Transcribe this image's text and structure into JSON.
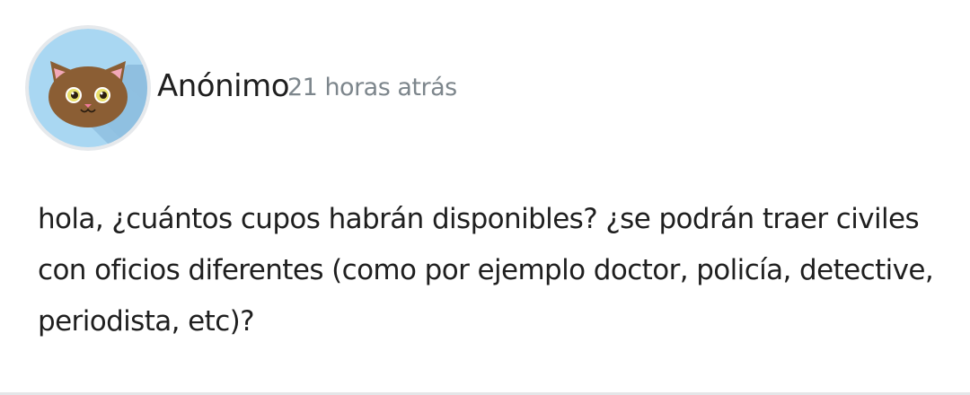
{
  "comment": {
    "avatar_icon": "cat-face-icon",
    "author": "Anónimo",
    "timestamp": "21 horas atrás",
    "body": "hola, ¿cuántos cupos habrán disponibles? ¿se podrán traer civiles con oficios diferentes (como por ejemplo doctor, policía, detective, periodista, etc)?"
  },
  "colors": {
    "avatar_bg": "#a9d7f2",
    "avatar_shadow": "#8fbfe0",
    "cat_fur": "#8b5e34",
    "cat_ear_inner": "#f2a8b8",
    "cat_eyes": "#e8e06a",
    "timestamp": "#7d868c",
    "text": "#1f1f1f"
  }
}
